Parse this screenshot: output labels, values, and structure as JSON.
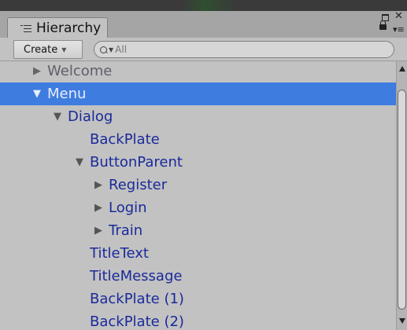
{
  "tab": {
    "label": "Hierarchy",
    "icon": "hierarchy-list-icon"
  },
  "toolbar": {
    "create_label": "Create",
    "search_placeholder": "All"
  },
  "colors": {
    "selection": "#3e7ce0",
    "item_text": "#1a2a9a",
    "background": "#c2c2c2"
  },
  "tree": [
    {
      "label": "Welcome",
      "expander": "collapsed"
    },
    {
      "label": "Menu",
      "expander": "expanded",
      "selected": true
    },
    {
      "label": "Dialog",
      "expander": "expanded"
    },
    {
      "label": "BackPlate",
      "expander": "none"
    },
    {
      "label": "ButtonParent",
      "expander": "expanded"
    },
    {
      "label": "Register",
      "expander": "collapsed"
    },
    {
      "label": "Login",
      "expander": "collapsed"
    },
    {
      "label": "Train",
      "expander": "collapsed"
    },
    {
      "label": "TitleText",
      "expander": "none"
    },
    {
      "label": "TitleMessage",
      "expander": "none"
    },
    {
      "label": "BackPlate (1)",
      "expander": "none"
    },
    {
      "label": "BackPlate (2)",
      "expander": "none"
    }
  ]
}
